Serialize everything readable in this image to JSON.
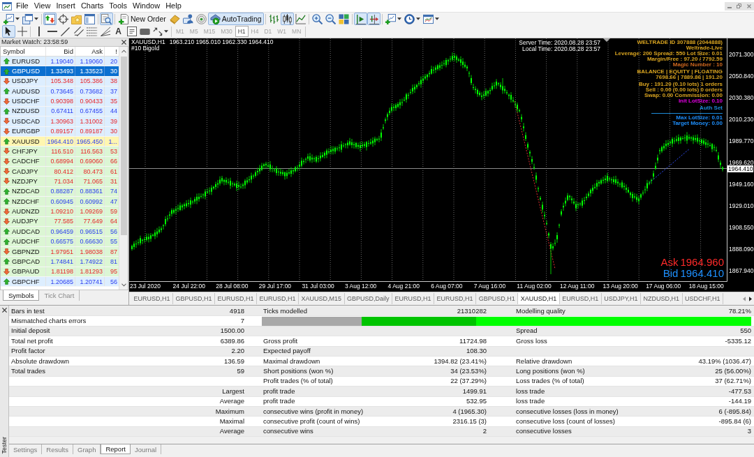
{
  "menu_bar": {
    "items": [
      "File",
      "View",
      "Insert",
      "Charts",
      "Tools",
      "Window",
      "Help"
    ]
  },
  "toolbar_1": {
    "groups": [
      [
        {
          "kind": "split",
          "on": false
        },
        {
          "kind": "split",
          "on": false
        }
      ],
      [
        {
          "kind": "icon",
          "on": true
        },
        {
          "kind": "icon",
          "on": false
        },
        {
          "kind": "icon",
          "on": false
        },
        {
          "kind": "icon",
          "on": false
        }
      ],
      [
        {
          "kind": "icon",
          "on": true
        }
      ],
      [
        {
          "kind": "labeled",
          "label": "New Order",
          "on": false
        },
        {
          "kind": "icon",
          "on": false
        },
        {
          "kind": "icon",
          "on": false
        },
        {
          "kind": "icon",
          "on": false
        },
        {
          "kind": "labeled",
          "label": "AutoTrading",
          "on": true
        }
      ],
      [
        {
          "kind": "icon",
          "on": false
        },
        {
          "kind": "icon",
          "on": true
        },
        {
          "kind": "icon",
          "on": false
        }
      ],
      [
        {
          "kind": "icon",
          "on": false
        },
        {
          "kind": "icon",
          "on": false
        },
        {
          "kind": "icon",
          "on": false
        }
      ],
      [
        {
          "kind": "icon",
          "on": true
        },
        {
          "kind": "icon",
          "on": true
        }
      ],
      [
        {
          "kind": "split",
          "on": false
        },
        {
          "kind": "split",
          "on": false
        },
        {
          "kind": "split",
          "on": false
        }
      ]
    ]
  },
  "toolbar_2": {
    "groups": [
      [
        {
          "kind": "icon",
          "on": true
        },
        {
          "kind": "icon",
          "on": false
        }
      ],
      [
        {
          "kind": "icon",
          "on": false
        },
        {
          "kind": "icon",
          "on": false
        },
        {
          "kind": "icon",
          "on": false
        },
        {
          "kind": "icon",
          "on": false
        },
        {
          "kind": "icon",
          "on": false
        },
        {
          "kind": "icon",
          "on": false
        },
        {
          "kind": "glyph",
          "glyph": "A",
          "on": false
        },
        {
          "kind": "icon",
          "on": false
        },
        {
          "kind": "icon",
          "on": false
        },
        {
          "kind": "split",
          "on": false
        }
      ]
    ],
    "periods": [
      {
        "label": "M1",
        "selected": false
      },
      {
        "label": "M5",
        "selected": false
      },
      {
        "label": "M15",
        "selected": false
      },
      {
        "label": "M30",
        "selected": false
      },
      {
        "label": "H1",
        "selected": true
      },
      {
        "label": "H4",
        "selected": false
      },
      {
        "label": "D1",
        "selected": false
      },
      {
        "label": "W1",
        "selected": false
      },
      {
        "label": "MN",
        "selected": false
      }
    ]
  },
  "market_watch": {
    "title": "Market Watch: 23:58:59",
    "columns": [
      "Symbol",
      "Bid",
      "Ask",
      "!"
    ],
    "rows": [
      {
        "symbol": "EURUSD",
        "bid": "1.19040",
        "ask": "1.19060",
        "column_4": "20",
        "rising": true,
        "color": "#ddeeff",
        "selected": false
      },
      {
        "symbol": "GBPUSD",
        "bid": "1.33493",
        "ask": "1.33523",
        "column_4": "30",
        "rising": true,
        "selected": true
      },
      {
        "symbol": "USDJPY",
        "bid": "105.348",
        "ask": "105.386",
        "column_4": "38",
        "rising": false,
        "color": "#ddeeff",
        "selected": false
      },
      {
        "symbol": "AUDUSD",
        "bid": "0.73645",
        "ask": "0.73682",
        "column_4": "37",
        "rising": true,
        "color": "#ddeeff",
        "selected": false
      },
      {
        "symbol": "USDCHF",
        "bid": "0.90398",
        "ask": "0.90433",
        "column_4": "35",
        "rising": false,
        "color": "#ddeeff",
        "selected": false
      },
      {
        "symbol": "NZDUSD",
        "bid": "0.67411",
        "ask": "0.67455",
        "column_4": "44",
        "rising": true,
        "color": "#ddeeff",
        "selected": false
      },
      {
        "symbol": "USDCAD",
        "bid": "1.30963",
        "ask": "1.31002",
        "column_4": "39",
        "rising": false,
        "color": "#ddeeff",
        "selected": false
      },
      {
        "symbol": "EURGBP",
        "bid": "0.89157",
        "ask": "0.89187",
        "column_4": "30",
        "rising": false,
        "color": "#ddeeff",
        "selected": false
      },
      {
        "symbol": "XAUUSD",
        "bid": "1964.410",
        "ask": "1965.450",
        "column_4": "1...",
        "rising": true,
        "color": "#fff6b0",
        "selected": false
      },
      {
        "symbol": "CHFJPY",
        "bid": "116.510",
        "ask": "116.563",
        "column_4": "53",
        "rising": false,
        "color": "#dcf6d4",
        "selected": false
      },
      {
        "symbol": "CADCHF",
        "bid": "0.68994",
        "ask": "0.69060",
        "column_4": "66",
        "rising": false,
        "color": "#dcf6d4",
        "selected": false
      },
      {
        "symbol": "CADJPY",
        "bid": "80.412",
        "ask": "80.473",
        "column_4": "61",
        "rising": false,
        "color": "#dcf6d4",
        "selected": false
      },
      {
        "symbol": "NZDJPY",
        "bid": "71.034",
        "ask": "71.065",
        "column_4": "31",
        "rising": false,
        "color": "#dcf6d4",
        "selected": false
      },
      {
        "symbol": "NZDCAD",
        "bid": "0.88287",
        "ask": "0.88361",
        "column_4": "74",
        "rising": true,
        "color": "#dcf6d4",
        "selected": false
      },
      {
        "symbol": "NZDCHF",
        "bid": "0.60945",
        "ask": "0.60992",
        "column_4": "47",
        "rising": true,
        "color": "#dcf6d4",
        "selected": false
      },
      {
        "symbol": "AUDNZD",
        "bid": "1.09210",
        "ask": "1.09269",
        "column_4": "59",
        "rising": false,
        "color": "#dcf6d4",
        "selected": false
      },
      {
        "symbol": "AUDJPY",
        "bid": "77.585",
        "ask": "77.649",
        "column_4": "64",
        "rising": false,
        "color": "#dcf6d4",
        "selected": false
      },
      {
        "symbol": "AUDCAD",
        "bid": "0.96459",
        "ask": "0.96515",
        "column_4": "56",
        "rising": true,
        "color": "#dcf6d4",
        "selected": false
      },
      {
        "symbol": "AUDCHF",
        "bid": "0.66575",
        "ask": "0.66630",
        "column_4": "55",
        "rising": true,
        "color": "#dcf6d4",
        "selected": false
      },
      {
        "symbol": "GBPNZD",
        "bid": "1.97951",
        "ask": "1.98038",
        "column_4": "87",
        "rising": false,
        "color": "#dcf6d4",
        "selected": false
      },
      {
        "symbol": "GBPCAD",
        "bid": "1.74841",
        "ask": "1.74922",
        "column_4": "81",
        "rising": true,
        "color": "#dcf6d4",
        "selected": false
      },
      {
        "symbol": "GBPAUD",
        "bid": "1.81198",
        "ask": "1.81293",
        "column_4": "95",
        "rising": false,
        "color": "#dcf6d4",
        "selected": false
      },
      {
        "symbol": "GBPCHF",
        "bid": "1.20685",
        "ask": "1.20741",
        "column_4": "56",
        "rising": true,
        "color": "#ddeeff",
        "selected": false
      }
    ],
    "tabs": [
      {
        "label": "Symbols",
        "selected": true
      },
      {
        "label": "Tick Chart",
        "selected": false
      }
    ]
  },
  "chart": {
    "symbol_period": "XAUUSD,H1",
    "ohlc": "1963.210 1965.010 1962.330 1964.410",
    "expert": "#10 Bigold",
    "server_time": "Server Time: 2020.08.28 23:57",
    "local_time": "Local Time: 2020.08.28 23:57",
    "info_groups": [
      [
        {
          "kind": "text",
          "text": "WELTRADE ID 307888 (2044888)",
          "color": "#daa520"
        },
        {
          "kind": "text",
          "text": "Weltrade-Live",
          "color": "#daa520"
        },
        {
          "kind": "text",
          "text": "Leverage: 200 Spread: 550 Lot Size: 0.01",
          "color": "#daa520"
        },
        {
          "kind": "text",
          "text": "Margin/Free : 97.20 / 7792.59",
          "color": "#daa520"
        },
        {
          "kind": "text",
          "text": "Magic Number : 10",
          "color": "#d2691e"
        }
      ],
      [
        {
          "kind": "text",
          "text": "BALANCE | EQUITY | FLOATING",
          "color": "#daa520"
        },
        {
          "kind": "text",
          "text": "7698.66 | 7889.86 | 191.20",
          "color": "#daa520"
        }
      ],
      [
        {
          "kind": "text",
          "text": "Buy : 191.20 (0.10 lots) 1 orders",
          "color": "#daa520"
        },
        {
          "kind": "text",
          "text": "Sell : 0.00 (0.00 lots) 0 orders",
          "color": "#daa520"
        },
        {
          "kind": "text",
          "text": "Swap: 0.00 Commission: 0.00",
          "color": "#daa520"
        },
        {
          "kind": "text",
          "text": "Init LotSize: 0.10",
          "color": "#e000e0"
        }
      ],
      [
        {
          "kind": "text",
          "text": "Auth Set",
          "color": "#1c8ad8"
        }
      ],
      [
        {
          "kind": "rule",
          "color": "#1c8ad8"
        },
        {
          "kind": "text",
          "text": "Max LotSize: 0.01",
          "color": "#1e90ff"
        },
        {
          "kind": "text",
          "text": "Target Money: 0.00",
          "color": "#1e90ff"
        }
      ]
    ],
    "ask": {
      "label": "Ask",
      "value": "1964.960"
    },
    "bid": {
      "label": "Bid",
      "value": "1964.410"
    },
    "price_labels": [
      "2071.300",
      "2050.840",
      "2030.380",
      "2010.230",
      "1989.770",
      "1969.620",
      "1949.160",
      "1929.010",
      "1908.550",
      "1888.090",
      "1867.940"
    ],
    "current_price": "1964.410",
    "time_labels": [
      "23 Jul 2020",
      "24 Jul 22:00",
      "28 Jul 08:00",
      "29 Jul 17:00",
      "31 Jul 03:00",
      "3 Aug 12:00",
      "4 Aug 21:00",
      "6 Aug 07:00",
      "7 Aug 16:00",
      "11 Aug 02:00",
      "12 Aug 11:00",
      "13 Aug 20:00",
      "17 Aug 06:00",
      "18 Aug 15:00"
    ]
  },
  "chart_tabs": [
    {
      "label": "EURUSD,H1",
      "selected": false
    },
    {
      "label": "GBPUSD,H1",
      "selected": false
    },
    {
      "label": "EURUSD,H1",
      "selected": false
    },
    {
      "label": "EURUSD,H1",
      "selected": false
    },
    {
      "label": "XAUUSD,M15",
      "selected": false
    },
    {
      "label": "GBPUSD,Daily",
      "selected": false
    },
    {
      "label": "EURUSD,H1",
      "selected": false
    },
    {
      "label": "EURUSD,H1",
      "selected": false
    },
    {
      "label": "GBPUSD,H1",
      "selected": false
    },
    {
      "label": "XAUUSD,H1",
      "selected": true
    },
    {
      "label": "EURUSD,H1",
      "selected": false
    },
    {
      "label": "USDJPY,H1",
      "selected": false
    },
    {
      "label": "NZDUSD,H1",
      "selected": false
    },
    {
      "label": "USDCHF,H1",
      "selected": false
    }
  ],
  "tester": {
    "title": "Tester",
    "report": {
      "rows": [
        {
          "left": {
            "label": "Bars in test",
            "value": "4918"
          },
          "middle": {
            "label": "Ticks modelled",
            "value": "21310282"
          },
          "right": {
            "label": "Modelling quality",
            "value": "78.21%"
          }
        },
        {
          "left": {
            "label": "Mismatched charts errors",
            "value": "7"
          },
          "quality_bar": {
            "segments": [
              {
                "color": "#a8a8a8",
                "level": 0.204
              },
              {
                "color": "#00c400",
                "level": 0.234
              },
              {
                "color": "#00ff00",
                "level": 0.562
              }
            ]
          }
        },
        {
          "left": {
            "label": "Initial deposit",
            "value": "1500.00"
          },
          "right": {
            "label": "Spread",
            "value": "550"
          }
        },
        {
          "left": {
            "label": "Total net profit",
            "value": "6389.86"
          },
          "middle": {
            "label": "Gross profit",
            "value": "11724.98"
          },
          "right": {
            "label": "Gross loss",
            "value": "-5335.12"
          }
        },
        {
          "left": {
            "label": "Profit factor",
            "value": "2.20"
          },
          "middle": {
            "label": "Expected payoff",
            "value": "108.30"
          }
        },
        {
          "left": {
            "label": "Absolute drawdown",
            "value": "136.59"
          },
          "middle": {
            "label": "Maximal drawdown",
            "value": "1394.82 (23.41%)"
          },
          "right": {
            "label": "Relative drawdown",
            "value": "43.19% (1036.47)"
          }
        },
        {
          "left": {
            "label": "Total trades",
            "value": "59"
          },
          "middle": {
            "label": "Short positions (won %)",
            "value": "34 (23.53%)"
          },
          "right": {
            "label": "Long positions (won %)",
            "value": "25 (56.00%)"
          }
        },
        {
          "middle": {
            "label": "Profit trades (% of total)",
            "value": "22 (37.29%)"
          },
          "right": {
            "label": "Loss trades (% of total)",
            "value": "37 (62.71%)"
          }
        },
        {
          "left": {
            "qualifier": "Largest"
          },
          "middle": {
            "label": "profit trade",
            "value": "1499.91"
          },
          "right": {
            "label": "loss trade",
            "value": "-477.53"
          }
        },
        {
          "left": {
            "qualifier": "Average"
          },
          "middle": {
            "label": "profit trade",
            "value": "532.95"
          },
          "right": {
            "label": "loss trade",
            "value": "-144.19"
          }
        },
        {
          "left": {
            "qualifier": "Maximum"
          },
          "middle": {
            "label": "consecutive wins (profit in money)",
            "value": "4 (1965.30)"
          },
          "right": {
            "label": "consecutive losses (loss in money)",
            "value": "6 (-895.84)"
          }
        },
        {
          "left": {
            "qualifier": "Maximal"
          },
          "middle": {
            "label": "consecutive profit (count of wins)",
            "value": "2316.15 (3)"
          },
          "right": {
            "label": "consecutive loss (count of losses)",
            "value": "-895.84 (6)"
          }
        },
        {
          "left": {
            "qualifier": "Average"
          },
          "middle": {
            "label": "consecutive wins",
            "value": "2"
          },
          "right": {
            "label": "consecutive losses",
            "value": "3"
          }
        }
      ]
    },
    "tabs": [
      {
        "label": "Settings",
        "selected": false
      },
      {
        "label": "Results",
        "selected": false
      },
      {
        "label": "Graph",
        "selected": false
      },
      {
        "label": "Report",
        "selected": true
      },
      {
        "label": "Journal",
        "selected": false
      }
    ]
  }
}
